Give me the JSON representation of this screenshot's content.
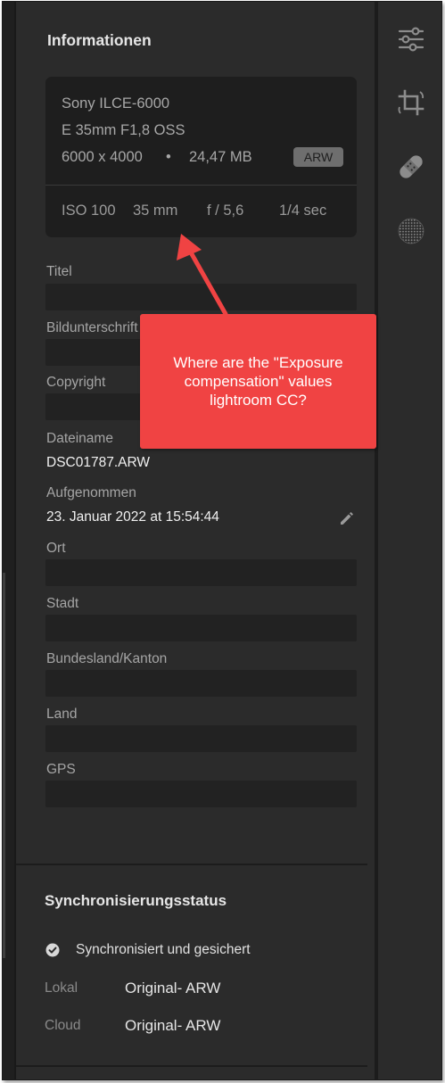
{
  "info": {
    "heading": "Informationen",
    "camera": "Sony ILCE-6000",
    "lens": "E 35mm F1,8 OSS",
    "dimensions": "6000 x 4000",
    "bullet": "•",
    "filesize": "24,47 MB",
    "format_badge": "ARW",
    "iso": "ISO 100",
    "focal_length": "35 mm",
    "aperture": "f / 5,6",
    "shutter": "1/4 sec"
  },
  "fields": {
    "title": "Titel",
    "caption": "Bildunterschrift",
    "copyright": "Copyright",
    "filename_label": "Dateiname",
    "filename_value": "DSC01787.ARW",
    "captured_label": "Aufgenommen",
    "captured_value": "23. Januar 2022 at 15:54:44",
    "location": "Ort",
    "city": "Stadt",
    "state": "Bundesland/Kanton",
    "country": "Land",
    "gps": "GPS"
  },
  "sync": {
    "heading": "Synchronisierungsstatus",
    "status": "Synchronisiert und gesichert",
    "local_label": "Lokal",
    "local_value": "Original- ARW",
    "cloud_label": "Cloud",
    "cloud_value": "Original- ARW"
  },
  "callout": {
    "text": "Where are the \"Exposure compensation\" values lightroom CC?"
  },
  "toolbar": {
    "icons": [
      "edit-sliders-icon",
      "crop-rotate-icon",
      "healing-bandage-icon",
      "masking-icon"
    ]
  },
  "colors": {
    "panel_bg": "#2b2b2b",
    "card_bg": "#1e1e1e",
    "callout_bg": "#f04343",
    "icon_gray": "#8c8c8c"
  }
}
